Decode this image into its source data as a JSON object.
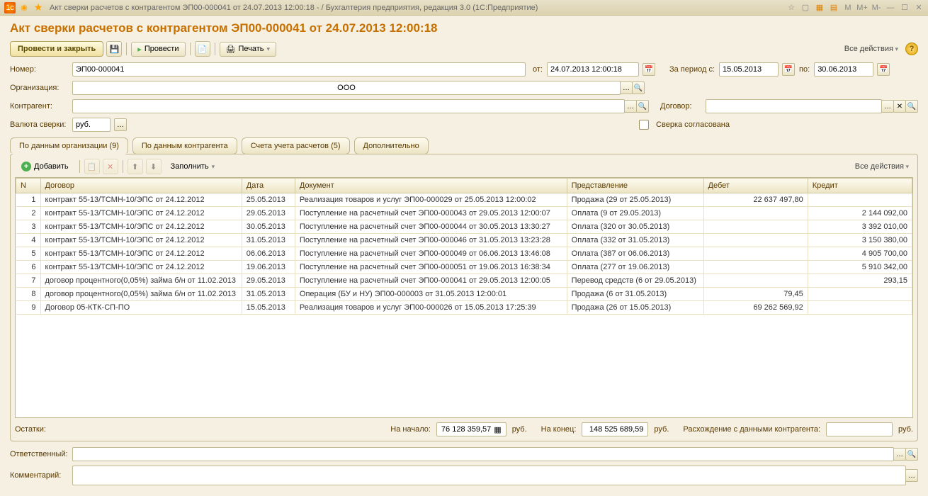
{
  "titlebar": {
    "text": "Акт сверки расчетов с контрагентом ЭП00-000041 от 24.07.2013 12:00:18 -                                    / Бухгалтерия предприятия, редакция 3.0   (1С:Предприятие)"
  },
  "page_title": "Акт сверки расчетов с контрагентом ЭП00-000041 от 24.07.2013 12:00:18",
  "toolbar": {
    "post_close": "Провести и закрыть",
    "post": "Провести",
    "print": "Печать",
    "all_actions": "Все действия"
  },
  "form": {
    "number_label": "Номер:",
    "number_value": "ЭП00-000041",
    "from_label": "от:",
    "from_value": "24.07.2013 12:00:18",
    "period_from_label": "За период с:",
    "period_from_value": "15.05.2013",
    "period_to_label": "по:",
    "period_to_value": "30.06.2013",
    "org_label": "Организация:",
    "org_value": "ООО",
    "counterparty_label": "Контрагент:",
    "counterparty_value": "",
    "contract_label": "Договор:",
    "contract_value": "",
    "currency_label": "Валюта сверки:",
    "currency_value": "руб.",
    "agreed_label": "Сверка согласована"
  },
  "tabs": {
    "t1": "По данным организации (9)",
    "t2": "По данным контрагента",
    "t3": "Счета учета расчетов (5)",
    "t4": "Дополнительно"
  },
  "panel_toolbar": {
    "add": "Добавить",
    "fill": "Заполнить",
    "all_actions": "Все действия"
  },
  "columns": {
    "n": "N",
    "contract": "Договор",
    "date": "Дата",
    "document": "Документ",
    "representation": "Представление",
    "debit": "Дебет",
    "credit": "Кредит"
  },
  "rows": [
    {
      "n": "1",
      "contract": "контракт 55-13/ТСМН-10/ЭПС от 24.12.2012",
      "date": "25.05.2013",
      "doc": "Реализация товаров и услуг ЭП00-000029 от 25.05.2013 12:00:02",
      "rep": "Продажа (29 от 25.05.2013)",
      "debit": "22 637 497,80",
      "credit": ""
    },
    {
      "n": "2",
      "contract": "контракт 55-13/ТСМН-10/ЭПС от 24.12.2012",
      "date": "29.05.2013",
      "doc": "Поступление на расчетный счет ЭП00-000043 от 29.05.2013 12:00:07",
      "rep": "Оплата (9 от 29.05.2013)",
      "debit": "",
      "credit": "2 144 092,00"
    },
    {
      "n": "3",
      "contract": "контракт 55-13/ТСМН-10/ЭПС от 24.12.2012",
      "date": "30.05.2013",
      "doc": "Поступление на расчетный счет ЭП00-000044 от 30.05.2013 13:30:27",
      "rep": "Оплата (320 от 30.05.2013)",
      "debit": "",
      "credit": "3 392 010,00"
    },
    {
      "n": "4",
      "contract": "контракт 55-13/ТСМН-10/ЭПС от 24.12.2012",
      "date": "31.05.2013",
      "doc": "Поступление на расчетный счет ЭП00-000046 от 31.05.2013 13:23:28",
      "rep": "Оплата (332 от 31.05.2013)",
      "debit": "",
      "credit": "3 150 380,00"
    },
    {
      "n": "5",
      "contract": "контракт 55-13/ТСМН-10/ЭПС от 24.12.2012",
      "date": "06.06.2013",
      "doc": "Поступление на расчетный счет ЭП00-000049 от 06.06.2013 13:46:08",
      "rep": "Оплата (387 от 06.06.2013)",
      "debit": "",
      "credit": "4 905 700,00"
    },
    {
      "n": "6",
      "contract": "контракт 55-13/ТСМН-10/ЭПС от 24.12.2012",
      "date": "19.06.2013",
      "doc": "Поступление на расчетный счет ЭП00-000051 от 19.06.2013 16:38:34",
      "rep": "Оплата (277 от 19.06.2013)",
      "debit": "",
      "credit": "5 910 342,00"
    },
    {
      "n": "7",
      "contract": "договор процентного(0,05%) займа б/н от 11.02.2013",
      "date": "29.05.2013",
      "doc": "Поступление на расчетный счет ЭП00-000041 от 29.05.2013 12:00:05",
      "rep": "Перевод средств (6 от 29.05.2013)",
      "debit": "",
      "credit": "293,15"
    },
    {
      "n": "8",
      "contract": "договор процентного(0,05%) займа б/н от 11.02.2013",
      "date": "31.05.2013",
      "doc": "Операция (БУ и НУ) ЭП00-000003 от 31.05.2013 12:00:01",
      "rep": "Продажа (6 от 31.05.2013)",
      "debit": "79,45",
      "credit": ""
    },
    {
      "n": "9",
      "contract": "Договор 05-КТК-СП-ПО",
      "date": "15.05.2013",
      "doc": "Реализация товаров и услуг ЭП00-000026 от 15.05.2013 17:25:39",
      "rep": "Продажа (26 от 15.05.2013)",
      "debit": "69 262 569,92",
      "credit": ""
    }
  ],
  "totals": {
    "balances_label": "Остатки:",
    "start_label": "На начало:",
    "start_value": "76 128 359,57",
    "rub": "руб.",
    "end_label": "На конец:",
    "end_value": "148 525 689,59",
    "diff_label": "Расхождение с данными контрагента:",
    "diff_value": ""
  },
  "footer": {
    "responsible_label": "Ответственный:",
    "responsible_value": "",
    "comment_label": "Комментарий:",
    "comment_value": ""
  }
}
